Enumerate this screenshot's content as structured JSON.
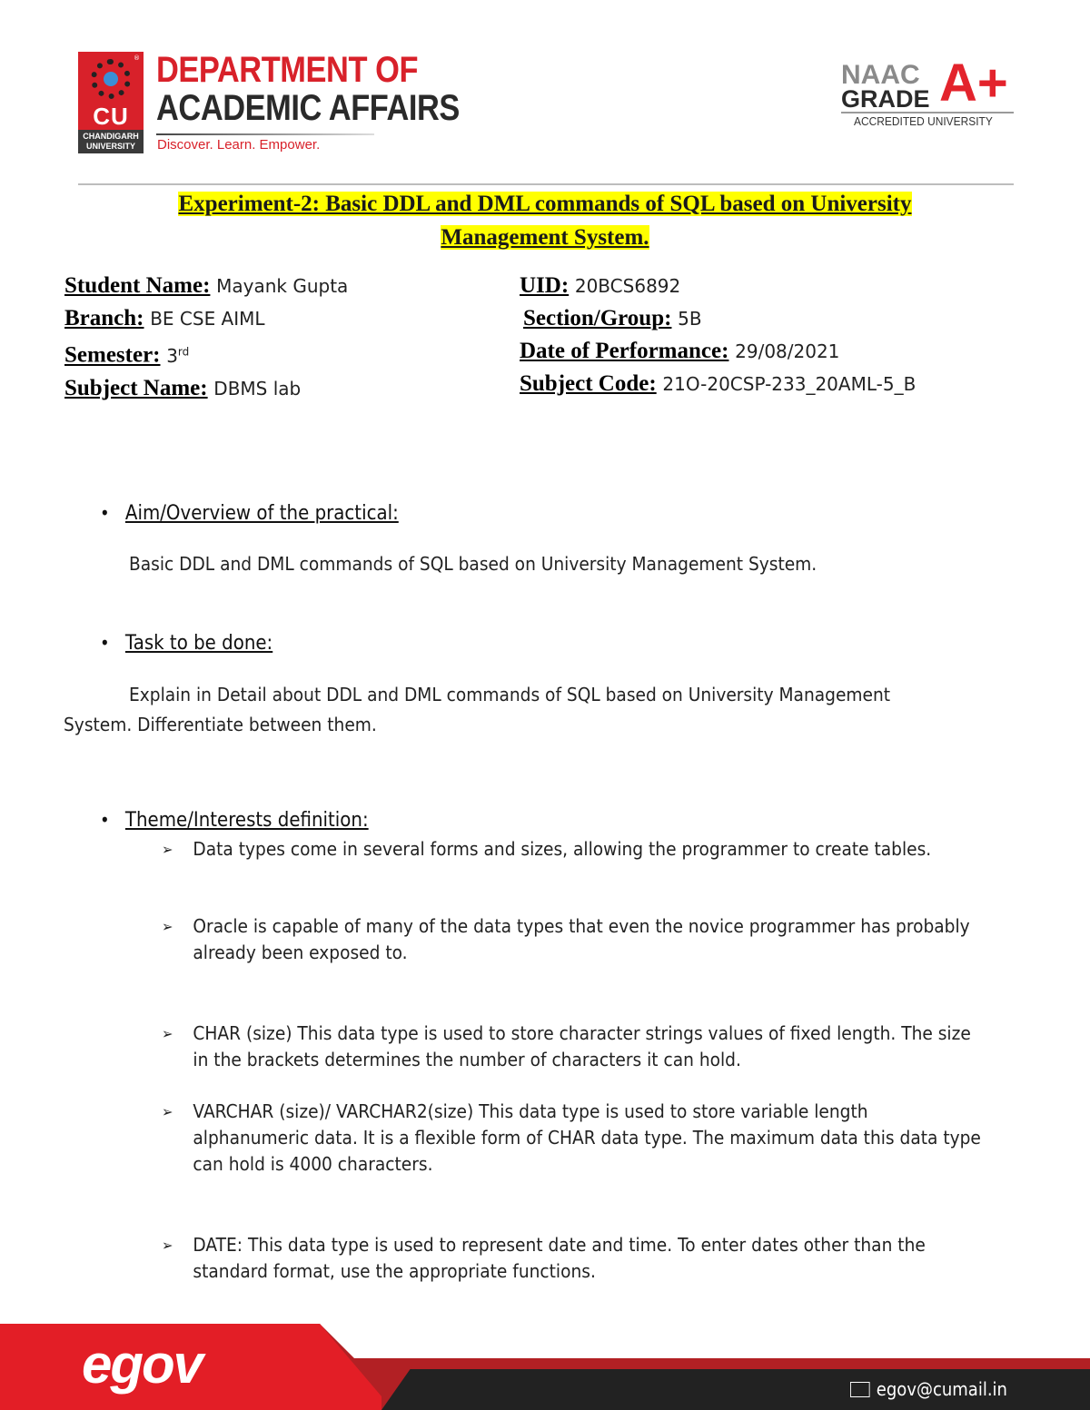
{
  "header": {
    "cu_logo": {
      "mark": "CU",
      "university_lines": [
        "CHANDIGARH",
        "UNIVERSITY"
      ],
      "registered": "®"
    },
    "department_lines": [
      "DEPARTMENT OF",
      "ACADEMIC AFFAIRS"
    ],
    "tagline": "Discover. Learn. Empower.",
    "naac": {
      "line1": "NAAC",
      "line2": "GRADE",
      "grade": "A+",
      "subtitle": "ACCREDITED UNIVERSITY"
    }
  },
  "title": {
    "line1": "Experiment-2: Basic  DDL  and  DML  commands  of  SQL based on University",
    "line2": "Management System."
  },
  "student_info": {
    "left": [
      {
        "label": "Student Name:",
        "value": "Mayank Gupta"
      },
      {
        "label": "Branch:",
        "value": "BE CSE AIML"
      },
      {
        "label": "Semester:",
        "value": "3",
        "sup": "rd"
      },
      {
        "label": "Subject Name:",
        "value": "DBMS lab"
      }
    ],
    "right": [
      {
        "label": "UID:",
        "value": "20BCS6892"
      },
      {
        "label": "Section/Group:",
        "value": "5B"
      },
      {
        "label": "Date of Performance:",
        "value": "29/08/2021"
      },
      {
        "label": "Subject Code:",
        "value": "21O-20CSP-233_20AML-5_B"
      }
    ]
  },
  "sections": {
    "aim": {
      "heading": "Aim/Overview of the practical:",
      "body": "Basic   DDL and DML commands of SQL based on University Management System."
    },
    "task": {
      "heading": "Task to be done:",
      "body_line1": "Explain in Detail about DDL and DML commands of SQL based on University Management",
      "body_line2": "System. Differentiate between them."
    },
    "theme": {
      "heading": "Theme/Interests definition:",
      "items": [
        "Data types come in several forms and sizes, allowing the programmer to create tables.",
        "Oracle is capable of many of the data types that even the novice programmer has probably already been exposed to.",
        "CHAR (size) This data type is used to store character strings values of fixed length. The size in the brackets determines the number of characters it can hold.",
        "VARCHAR (size)/ VARCHAR2(size) This data type is used to store variable length alphanumeric data. It is a flexible form of CHAR data type. The maximum data this data type can hold is 4000 characters.",
        "DATE: This data type is used to represent date and time. To enter dates other than the standard format, use the appropriate functions."
      ]
    }
  },
  "bullet_glyph": "•",
  "arrow_glyph": "➢",
  "footer": {
    "logo": "egov",
    "email": "egov@cumail.in",
    "email_icon": "envelope-icon"
  },
  "colors": {
    "brand_red": "#d8212a",
    "highlight": "#ffff00",
    "footer_dark": "#222222"
  }
}
